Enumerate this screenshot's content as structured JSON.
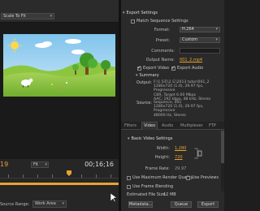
{
  "source": {
    "scale_value": "Scale To Fit",
    "timecode_current": "19",
    "fit_value": "Fit",
    "timecode_end": "00;16;16",
    "source_range_label": "Source Range:",
    "source_range_value": "Work Area"
  },
  "export": {
    "header": "Export Settings",
    "match_sequence_label": "Match Sequence Settings",
    "format_label": "Format:",
    "format_value": "H.264",
    "preset_label": "Preset:",
    "preset_value": "Custom",
    "comments_label": "Comments:",
    "output_name_label": "Output Name:",
    "output_name_value": "001_2.mp4",
    "export_video_label": "Export Video",
    "export_audio_label": "Export Audio"
  },
  "summary": {
    "header": "Summary",
    "output_key": "Output:",
    "output_lines": [
      "F:\\1.5조\\2.도\\2013 tutor\\001_2",
      "1280x720 (1.0), 29.97 fps, Progressive",
      "CBR, Target 6.00 Mbps",
      "AAC, 192 kbps, 48 kHz, Stereo"
    ],
    "source_key": "Source:",
    "source_lines": [
      "Sequence, 001",
      "1280x720 (1.0), 29.97 fps, Progressive",
      "48000 Hz, Stereo"
    ]
  },
  "tabs": [
    "Filters",
    "Video",
    "Audio",
    "Multiplexer",
    "FTP"
  ],
  "basic_video": {
    "header": "Basic Video Settings",
    "width_label": "Width:",
    "width_value": "1,280",
    "height_label": "Height:",
    "height_value": "720",
    "frame_rate_label": "Frame Rate:",
    "frame_rate_value": "29.97"
  },
  "render": {
    "max_quality_label": "Use Maximum Render Quality",
    "use_previews_label": "Use Previews",
    "frame_blending_label": "Use Frame Blending",
    "file_size_label": "Estimated File Size:",
    "file_size_value": "12 MB"
  },
  "buttons": {
    "metadata": "Metadata...",
    "queue": "Queue",
    "export": "Export"
  },
  "colors": {
    "accent": "#e8a230",
    "panel": "#2a2a2a"
  }
}
